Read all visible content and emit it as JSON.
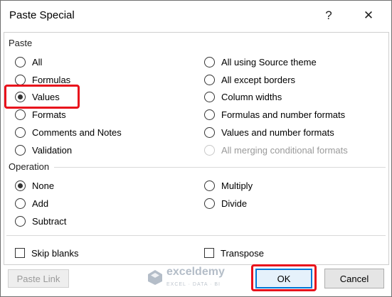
{
  "dialog": {
    "title": "Paste Special",
    "help_label": "?",
    "close_label": "✕"
  },
  "paste": {
    "section_label": "Paste",
    "left": [
      {
        "label": "All",
        "checked": false
      },
      {
        "label": "Formulas",
        "checked": false
      },
      {
        "label": "Values",
        "checked": true
      },
      {
        "label": "Formats",
        "checked": false
      },
      {
        "label": "Comments and Notes",
        "checked": false
      },
      {
        "label": "Validation",
        "checked": false
      }
    ],
    "right": [
      {
        "label": "All using Source theme",
        "checked": false
      },
      {
        "label": "All except borders",
        "checked": false
      },
      {
        "label": "Column widths",
        "checked": false
      },
      {
        "label": "Formulas and number formats",
        "checked": false
      },
      {
        "label": "Values and number formats",
        "checked": false
      },
      {
        "label": "All merging conditional formats",
        "checked": false,
        "disabled": true
      }
    ]
  },
  "operation": {
    "section_label": "Operation",
    "left": [
      {
        "label": "None",
        "checked": true
      },
      {
        "label": "Add",
        "checked": false
      },
      {
        "label": "Subtract",
        "checked": false
      }
    ],
    "right": [
      {
        "label": "Multiply",
        "checked": false
      },
      {
        "label": "Divide",
        "checked": false
      }
    ]
  },
  "options": {
    "skip_blanks": {
      "label": "Skip blanks",
      "checked": false
    },
    "transpose": {
      "label": "Transpose",
      "checked": false
    }
  },
  "buttons": {
    "paste_link": "Paste Link",
    "ok": "OK",
    "cancel": "Cancel"
  },
  "watermark": {
    "brand": "exceldemy",
    "tagline": "EXCEL · DATA · BI"
  },
  "colors": {
    "highlight": "#e8101b",
    "focus": "#0078d7"
  }
}
